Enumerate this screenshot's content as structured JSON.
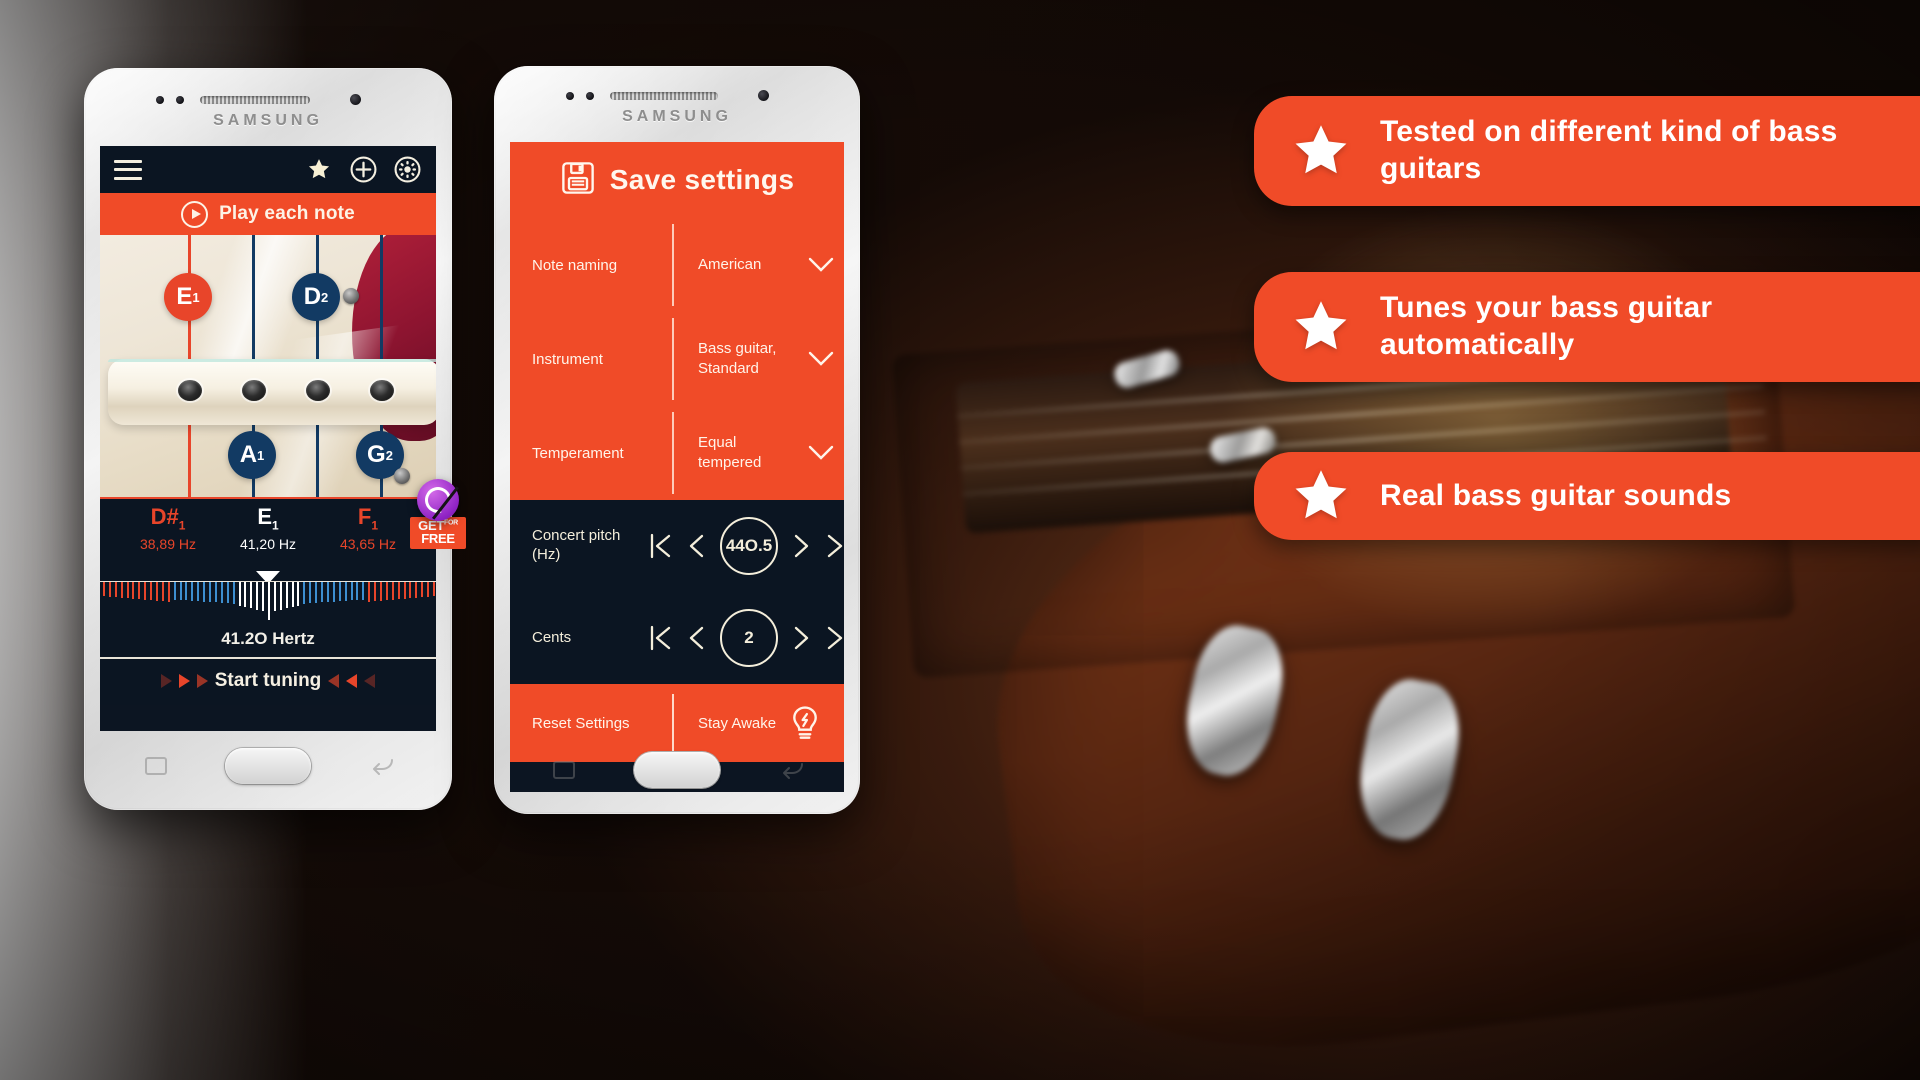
{
  "phone1": {
    "device_brand": "SAMSUNG",
    "topbar": {
      "menu_icon": "hamburger-menu-icon",
      "favorite_icon": "star-icon",
      "add_icon": "plus-circle-icon",
      "settings_icon": "gear-circle-icon"
    },
    "play_bar": {
      "label": "Play each note",
      "icon": "play-circle-icon"
    },
    "strings": [
      {
        "note": "E",
        "octave": "1",
        "color": "#e8452a",
        "state": "active"
      },
      {
        "note": "A",
        "octave": "1",
        "color": "#123a63",
        "state": "normal"
      },
      {
        "note": "D",
        "octave": "2",
        "color": "#123a63",
        "state": "normal"
      },
      {
        "note": "G",
        "octave": "2",
        "color": "#123a63",
        "state": "normal"
      }
    ],
    "readout": {
      "left": {
        "note": "D#",
        "octave": "1",
        "hz": "38,89 Hz"
      },
      "center": {
        "note": "E",
        "octave": "1",
        "hz": "41,20 Hz"
      },
      "right": {
        "note": "F",
        "octave": "1",
        "hz": "43,65 Hz"
      }
    },
    "hertz_value": "41.2O Hertz",
    "start_tuning": "Start tuning",
    "promo": {
      "line1": "GET",
      "small": "FOR",
      "line2": "FREE"
    }
  },
  "phone2": {
    "device_brand": "SAMSUNG",
    "header": {
      "title": "Save settings",
      "icon": "floppy-disk-save-icon"
    },
    "settings": [
      {
        "label": "Note naming",
        "value": "American",
        "icon": "chevron-down-icon"
      },
      {
        "label": "Instrument",
        "value": "Bass guitar, Standard",
        "icon": "chevron-down-icon"
      },
      {
        "label": "Temperament",
        "value": "Equal tempered",
        "icon": "chevron-down-icon"
      }
    ],
    "steppers": [
      {
        "label": "Concert pitch (Hz)",
        "value": "44O.5",
        "first": "skip-to-start-icon",
        "prev": "chevron-left-icon",
        "next": "chevron-right-icon",
        "last": "skip-to-end-icon"
      },
      {
        "label": "Cents",
        "value": "2",
        "first": "skip-to-start-icon",
        "prev": "chevron-left-icon",
        "next": "chevron-right-icon",
        "last": "skip-to-end-icon"
      }
    ],
    "footer": {
      "reset_label": "Reset Settings",
      "stay_awake_label": "Stay Awake",
      "stay_awake_icon": "lightbulb-icon"
    }
  },
  "banners": [
    {
      "icon": "star-icon",
      "text": "Tested on different kind of bass guitars"
    },
    {
      "icon": "star-icon",
      "text": "Tunes your bass guitar automatically"
    },
    {
      "icon": "star-icon",
      "text": "Real bass guitar sounds"
    }
  ],
  "colors": {
    "accent_orange": "#f04b28",
    "dark_navy": "#0b1522",
    "string_blue": "#123a63",
    "string_red": "#e8452a",
    "cream": "#f4eedb"
  }
}
